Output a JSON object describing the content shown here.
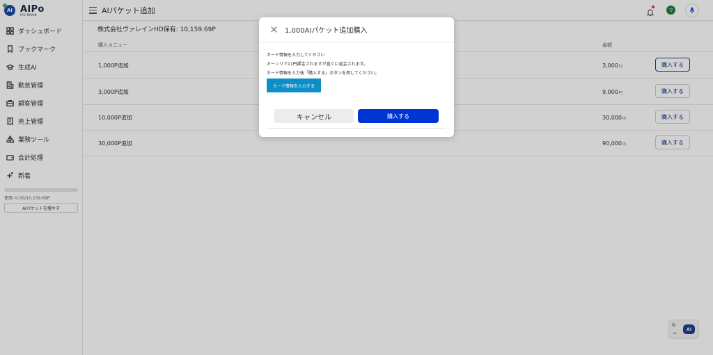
{
  "app": {
    "logo_main": "AIPo",
    "logo_sub": "IPO BRAIN",
    "logo_mark": "AI"
  },
  "sidebar": {
    "items": [
      {
        "label": "ダッシュボード",
        "icon": "dashboard-icon"
      },
      {
        "label": "ブックマーク",
        "icon": "bookmark-icon"
      },
      {
        "label": "生成AI",
        "icon": "graduation-cap-icon"
      },
      {
        "label": "勤怠管理",
        "icon": "building-icon"
      },
      {
        "label": "顧客管理",
        "icon": "briefcase-icon"
      },
      {
        "label": "売上管理",
        "icon": "receipt-icon"
      },
      {
        "label": "業務ツール",
        "icon": "shapes-icon"
      },
      {
        "label": "会計処理",
        "icon": "wallet-icon"
      },
      {
        "label": "新着",
        "icon": "sparkle-icon"
      }
    ],
    "usage_text": "使用: 0.00/10,159.69P",
    "usage_fraction": 0,
    "add_packet_label": "AIパケットを増やす"
  },
  "header": {
    "title": "AIパケット追加",
    "avatar_initial": "マ"
  },
  "main": {
    "company_balance": "株式会社ヴァレインHD保有: 10,159.69P",
    "col_menu": "購入メニュー",
    "col_price": "金額",
    "currency": "円",
    "rows": [
      {
        "name": "1,000P追加",
        "price": "3,000",
        "button": "購入する"
      },
      {
        "name": "3,000P追加",
        "price": "9,000",
        "button": "購入する"
      },
      {
        "name": "10,000P追加",
        "price": "30,000",
        "button": "購入する"
      },
      {
        "name": "30,000P追加",
        "price": "90,000",
        "button": "購入する"
      }
    ]
  },
  "modal": {
    "title": "1,000AIパケット追加購入",
    "line1": "カード情報を入力してください",
    "line2": "オーソリで11円課金されますが直ぐに返金されます。",
    "line3": "カード情報を入力後「購入する」ボタンを押してください。",
    "card_button": "カード情報を入力する",
    "cancel": "キャンセル",
    "confirm": "購入する"
  },
  "widget": {
    "ai_label": "AI"
  },
  "colors": {
    "primary": "#0035d5",
    "card_button": "#0d8ec6",
    "brand": "#1a4aa8"
  }
}
